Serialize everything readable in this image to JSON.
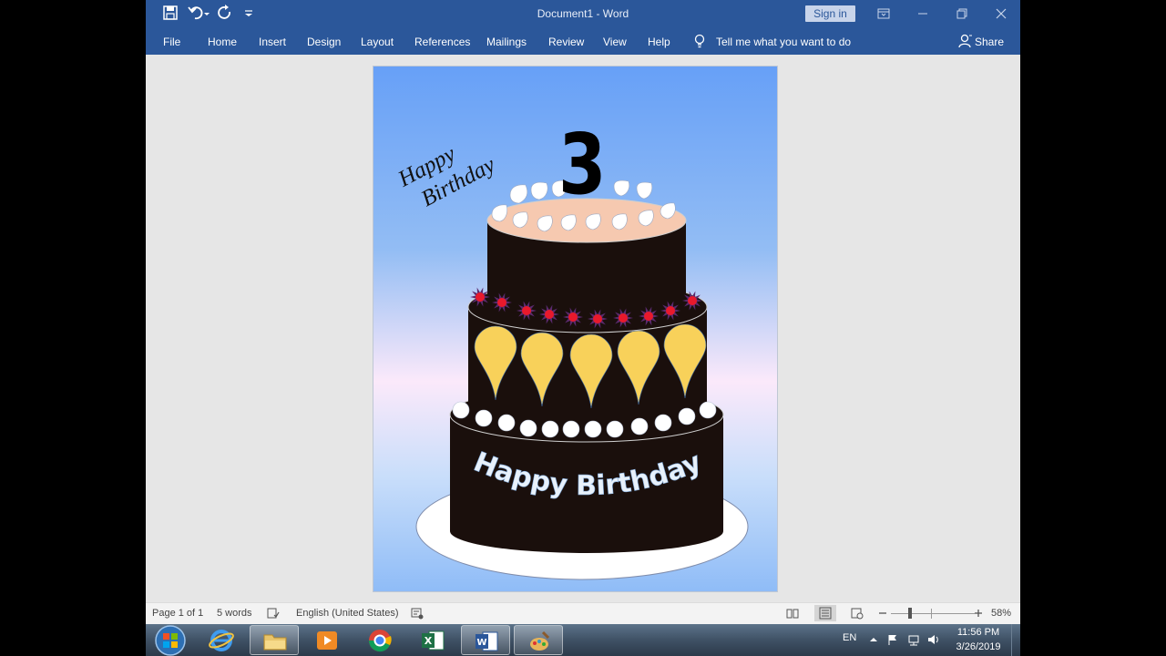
{
  "titlebar": {
    "doc_title": "Document1 - Word",
    "sign_in": "Sign in"
  },
  "ribbon": {
    "tabs": [
      "File",
      "Home",
      "Insert",
      "Design",
      "Layout",
      "References",
      "Mailings",
      "Review",
      "View",
      "Help"
    ],
    "tell_me": "Tell me what you want to do",
    "share": "Share"
  },
  "document": {
    "number": "3",
    "script_line1": "Happy",
    "script_line2": "Birthday",
    "cake_banner": "Happy Birthday"
  },
  "statusbar": {
    "page": "Page 1 of 1",
    "words": "5 words",
    "language": "English (United States)",
    "zoom": "58%"
  },
  "taskbar": {
    "lang": "EN",
    "time": "11:56 PM",
    "date": "3/26/2019"
  },
  "colors": {
    "accent": "#2b579a",
    "cake": "#1a0f0c",
    "frosting": "#f6c9b0",
    "balloon": "#f8d15a",
    "berry": "#e8192c"
  }
}
